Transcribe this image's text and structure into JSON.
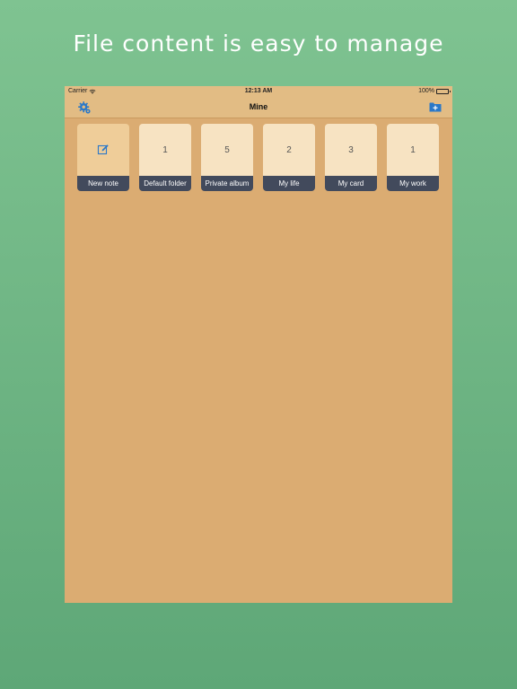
{
  "promo": {
    "headline": "File content is easy to manage"
  },
  "status_bar": {
    "carrier": "Carrier",
    "time": "12:13 AM",
    "battery": "100%"
  },
  "nav": {
    "title": "Mine",
    "left_icon": "settings-gear-icon",
    "right_icon": "add-folder-icon"
  },
  "tiles": [
    {
      "type": "action",
      "icon": "edit-icon",
      "label": "New note"
    },
    {
      "type": "folder",
      "count": "1",
      "label": "Default folder"
    },
    {
      "type": "folder",
      "count": "5",
      "label": "Private album"
    },
    {
      "type": "folder",
      "count": "2",
      "label": "My life"
    },
    {
      "type": "folder",
      "count": "3",
      "label": "My card"
    },
    {
      "type": "folder",
      "count": "1",
      "label": "My work"
    }
  ],
  "colors": {
    "background_top": "#7fc391",
    "background_bottom": "#5ea777",
    "device_background": "#dbac72",
    "nav_background": "#e2bc84",
    "tile_background": "#f7e3c2",
    "tile_label_background": "#424a5c",
    "accent_blue": "#2a78c8"
  }
}
